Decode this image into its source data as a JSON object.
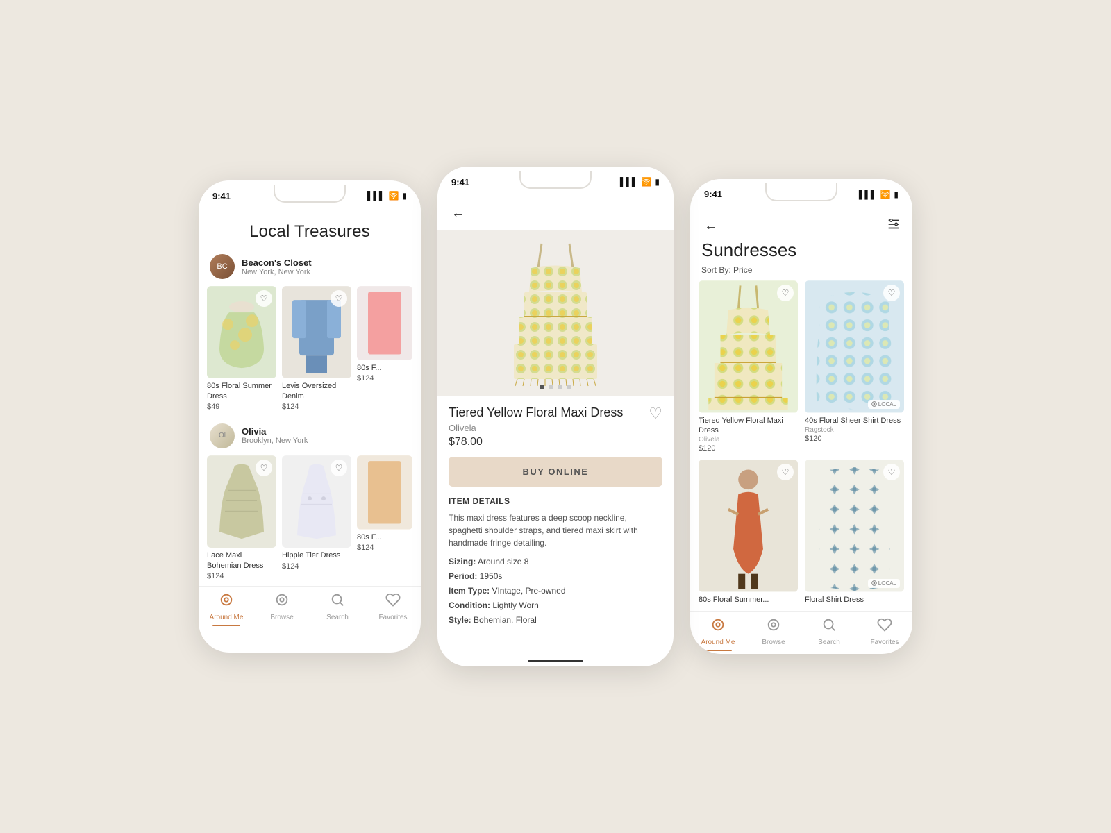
{
  "background": "#ede8e0",
  "phone1": {
    "status_time": "9:41",
    "title": "Local Treasures",
    "seller1": {
      "name": "Beacon's Closet",
      "location": "New York, New York"
    },
    "seller1_products": [
      {
        "name": "80s Floral Summer Dress",
        "price": "$49"
      },
      {
        "name": "Levis Oversized Denim",
        "price": "$124"
      },
      {
        "name": "80s F...",
        "price": "$124"
      }
    ],
    "seller2": {
      "name": "Olivia",
      "location": "Brooklyn, New York"
    },
    "seller2_products": [
      {
        "name": "Lace Maxi Bohemian Dress",
        "price": "$124"
      },
      {
        "name": "Hippie Tier Dress",
        "price": "$124"
      },
      {
        "name": "80s F...",
        "price": "$124"
      }
    ],
    "nav": [
      {
        "label": "Around Me",
        "active": true
      },
      {
        "label": "Browse",
        "active": false
      },
      {
        "label": "Search",
        "active": false
      },
      {
        "label": "Favorites",
        "active": false
      }
    ]
  },
  "phone2": {
    "status_time": "9:41",
    "product_name": "Tiered Yellow Floral Maxi Dress",
    "shop_name": "Olivela",
    "price": "$78.00",
    "buy_label": "BUY ONLINE",
    "item_details_label": "ITEM DETAILS",
    "description": "This maxi dress features a deep scoop neckline, spaghetti shoulder straps, and tiered maxi skirt with handmade fringe detailing.",
    "attributes": [
      {
        "key": "Sizing:",
        "value": "Around size 8"
      },
      {
        "key": "Period:",
        "value": "1950s"
      },
      {
        "key": "Item Type:",
        "value": "VIntage, Pre-owned"
      },
      {
        "key": "Condition:",
        "value": "Lightly Worn"
      },
      {
        "key": "Style:",
        "value": "Bohemian, Floral"
      }
    ]
  },
  "phone3": {
    "status_time": "9:41",
    "title": "Sundresses",
    "sort_label": "Sort By:",
    "sort_value": "Price",
    "products": [
      {
        "name": "Tiered Yellow Floral Maxi Dress",
        "shop": "Olivela",
        "price": "$120",
        "local": false
      },
      {
        "name": "40s Floral Sheer Shirt Dress",
        "shop": "Ragstock",
        "price": "$120",
        "local": true
      },
      {
        "name": "Tiered Yellow Floral Maxi Dress",
        "shop": "Olivela",
        "price": "$120",
        "local": false
      },
      {
        "name": "Floral Shirt Dress",
        "shop": "",
        "price": "",
        "local": true
      }
    ],
    "partial_products": [
      {
        "name": "80s Floral Summer...",
        "shop": "",
        "price": ""
      },
      {
        "name": "Floral Shirt Dress",
        "shop": "",
        "price": ""
      }
    ],
    "nav": [
      {
        "label": "Around Me",
        "active": true
      },
      {
        "label": "Browse",
        "active": false
      },
      {
        "label": "Search",
        "active": false
      },
      {
        "label": "Favorites",
        "active": false
      }
    ]
  },
  "icons": {
    "heart": "♡",
    "heart_filled": "♥",
    "around_me": "◎",
    "browse": "◉",
    "search": "⌕",
    "favorites": "♡",
    "back": "←",
    "filter": "⊟"
  }
}
